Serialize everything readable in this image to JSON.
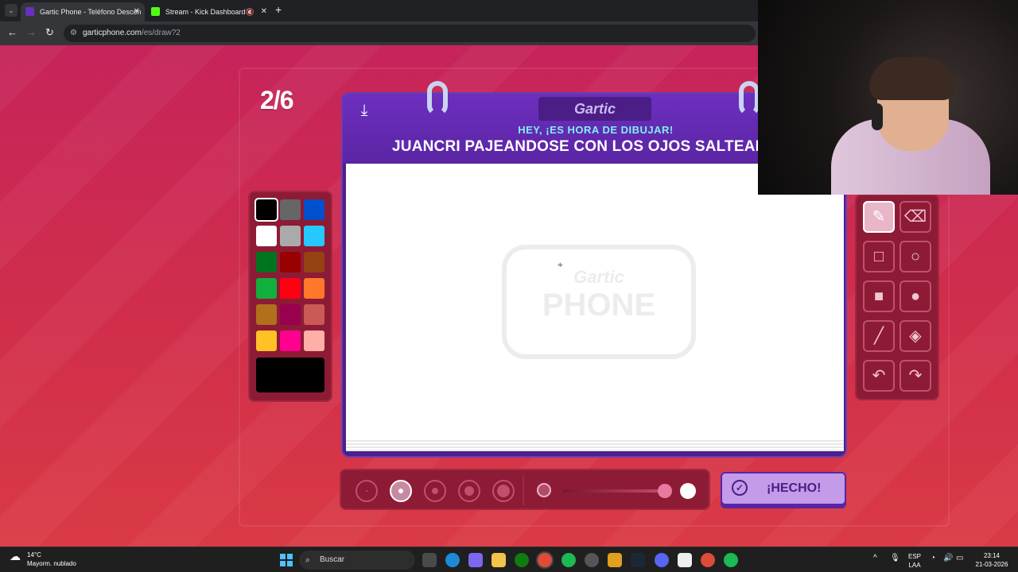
{
  "browser": {
    "tabs": [
      {
        "title": "Gartic Phone - Teléfono Descon",
        "active": true
      },
      {
        "title": "Stream - Kick Dashboard",
        "active": false
      }
    ],
    "new_tab": "+",
    "url_domain": "garticphone.com",
    "url_path": "/es/draw?2"
  },
  "game": {
    "round": "2/6",
    "logo": "Gartic",
    "prompt_hint": "HEY, ¡ES HORA DE DIBUJAR!",
    "prompt_text": "JUANCRI PAJEANDOSE CON LOS OJOS SALTEAD",
    "watermark_top": "Gartic",
    "watermark_bottom": "PHONE",
    "done_label": "¡HECHO!",
    "palette": [
      "#000000",
      "#666666",
      "#0050cd",
      "#ffffff",
      "#aaaaaa",
      "#26c9ff",
      "#017420",
      "#990000",
      "#964112",
      "#11b03c",
      "#ff0013",
      "#ff7829",
      "#b0701c",
      "#99004e",
      "#cb5a57",
      "#ffc126",
      "#ff008f",
      "#feafa8"
    ],
    "selected_color": "#000000",
    "tools": [
      "pencil",
      "eraser",
      "rectangle-outline",
      "ellipse-outline",
      "rectangle-filled",
      "ellipse-filled",
      "line",
      "fill-bucket",
      "undo",
      "redo"
    ],
    "active_tool": "pencil",
    "brush_sizes": 5,
    "active_brush_size": 2
  },
  "taskbar": {
    "temp": "14°C",
    "weather": "Mayorm. nublado",
    "search": "Buscar",
    "lang_top": "ESP",
    "lang_bottom": "LAA",
    "time": "23:14",
    "date": "21-03-2026"
  }
}
